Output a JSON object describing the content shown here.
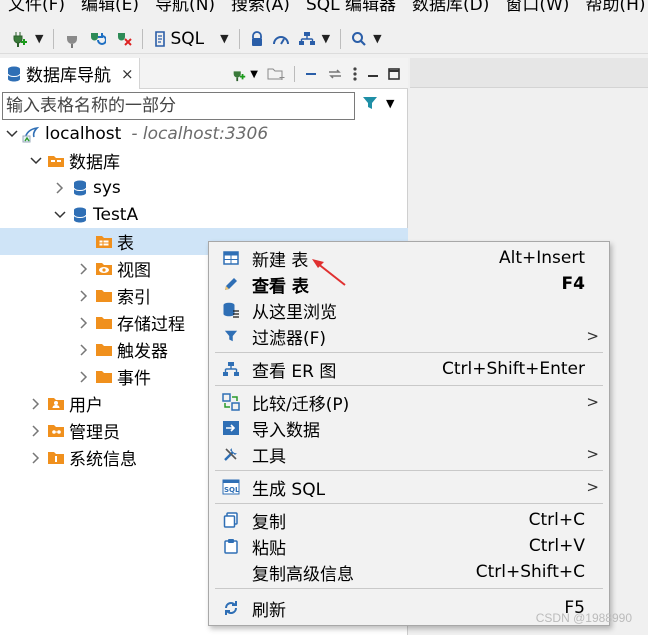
{
  "menubar": {
    "items": [
      "文件(F)",
      "编辑(E)",
      "导航(N)",
      "搜索(A)",
      "SQL 编辑器",
      "数据库(D)",
      "窗口(W)",
      "帮助(H)"
    ]
  },
  "toolbar": {
    "sql_label": "SQL"
  },
  "navigator": {
    "tab_title": "数据库导航",
    "tab_close": "×",
    "filter_placeholder": "输入表格名称的一部分"
  },
  "tree": {
    "connection": {
      "name": "localhost",
      "detail": "- localhost:3306"
    },
    "databases": "数据库",
    "sys": "sys",
    "testa": "TestA",
    "tables": "表",
    "views": "视图",
    "indexes": "索引",
    "procedures": "存储过程",
    "triggers": "触发器",
    "events": "事件",
    "users": "用户",
    "admins": "管理员",
    "sysinfo": "系统信息"
  },
  "context_menu": {
    "new_table": {
      "label_a": "新建",
      "label_b": "表",
      "shortcut": "Alt+Insert"
    },
    "view_table": {
      "label_a": "查看",
      "label_b": "表",
      "shortcut": "F4"
    },
    "browse_here": {
      "label": "从这里浏览"
    },
    "filter": {
      "label": "过滤器(F)"
    },
    "view_er": {
      "label": "查看 ER 图",
      "shortcut": "Ctrl+Shift+Enter"
    },
    "compare": {
      "label": "比较/迁移(P)"
    },
    "import": {
      "label": "导入数据"
    },
    "tools": {
      "label": "工具"
    },
    "gen_sql": {
      "label": "生成 SQL"
    },
    "copy": {
      "label": "复制",
      "shortcut": "Ctrl+C"
    },
    "paste": {
      "label": "粘贴",
      "shortcut": "Ctrl+V"
    },
    "copy_adv": {
      "label": "复制高级信息",
      "shortcut": "Ctrl+Shift+C"
    },
    "refresh": {
      "label": "刷新",
      "shortcut": "F5"
    }
  },
  "watermark": "CSDN @1988990",
  "colors": {
    "selection": "#cfe4f7",
    "folder": "#f0901d",
    "db_blue": "#2f6fb5",
    "arrow_red": "#e03030"
  }
}
